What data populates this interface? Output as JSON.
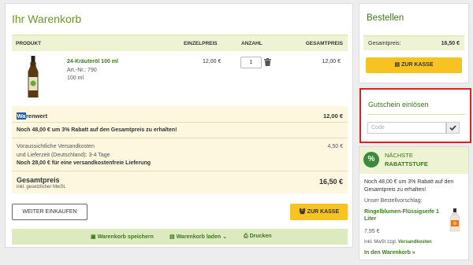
{
  "cart": {
    "title": "Ihr Warenkorb",
    "columns": {
      "product": "PRODUKT",
      "unit_price": "EINZELPREIS",
      "quantity": "ANZAHL",
      "total": "GESAMTPREIS"
    },
    "item": {
      "name": "24-Kräuteröl 100 ml",
      "article_no": "Art.-Nr.: 790",
      "size": "100 ml",
      "unit_price": "12,00 €",
      "quantity": "1",
      "total": "12,00 €"
    },
    "summary": {
      "goods_value_label_prefix": "Wa",
      "goods_value_label_rest": "renwert",
      "goods_value": "12,00 €",
      "discount_hint": "Noch 48,00 € um 3% Rabatt auf den Gesamtpreis zu erhalten!",
      "shipping_line1": "Voraussichtliche Versandkosten",
      "shipping_line2": "und Lieferzeit (Deutschland): 3-4 Tage",
      "shipping_free_hint": "Noch 28,00 € für eine versandkostenfreie Lieferung",
      "shipping_value": "4,50 €",
      "total_label": "Gesamtpreis",
      "total_sub": "inkl. gesetzlicher MwSt.",
      "total_value": "16,50 €"
    },
    "continue_button": "WEITER EINKAUFEN",
    "checkout_button": "ZUR KASSE",
    "actions": {
      "save": "Warenkorb speichern",
      "load": "Warenkorb laden",
      "print": "Drucken"
    }
  },
  "order": {
    "title": "Bestellen",
    "total_label": "Gesamtpreis:",
    "total_value": "16,50 €",
    "checkout_button": "ZUR KASSE"
  },
  "coupon": {
    "title": "Gutschein einlösen",
    "placeholder": "Code"
  },
  "next_discount": {
    "badge": "%",
    "title_line1": "NÄCHSTE",
    "title_line2": "RABATTSTUFE",
    "hint": "Noch 48,00 € um 3% Rabatt auf den Gesamtpreis zu erhalten!",
    "suggestion_label": "Unser Bestellvorschlag:",
    "product_name": "Ringelblumen-Flüssigseife 1 Liter",
    "price": "7,95 €",
    "price_note": "inkl. MwSt zzgl.",
    "shipping_link": "Versandkosten",
    "add_link": "In den Warenkorb »"
  },
  "colors": {
    "brand_green": "#6a9a1f",
    "dark_green": "#3b7a1a",
    "accent_yellow": "#f6c323",
    "highlight_border": "#e02020"
  }
}
